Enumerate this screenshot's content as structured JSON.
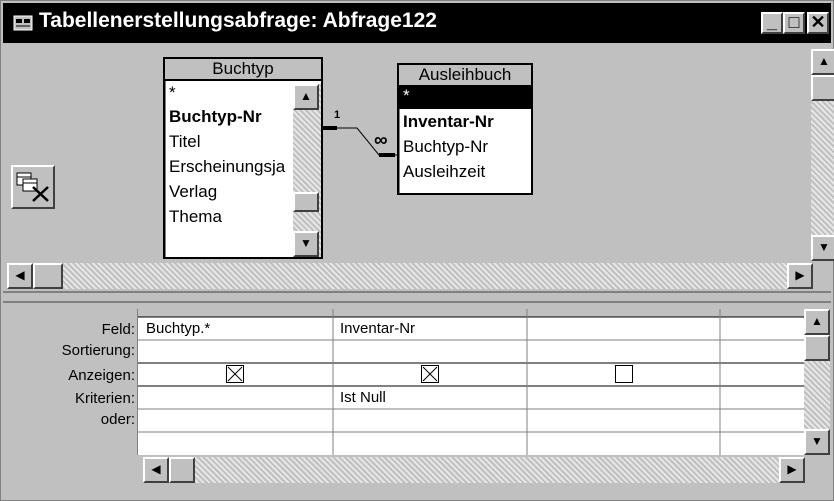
{
  "window": {
    "title": "Tabellenerstellungsabfrage: Abfrage122",
    "controls": {
      "minimize": "_",
      "maximize": "□",
      "close": "✕"
    }
  },
  "tables": [
    {
      "name": "Buchtyp",
      "fields": [
        "*",
        "Buchtyp-Nr",
        "Titel",
        "Erscheinungsja",
        "Verlag",
        "Thema"
      ]
    },
    {
      "name": "Ausleihbuch",
      "fields": [
        "*",
        "Inventar-Nr",
        "Buchtyp-Nr",
        "Ausleihzeit"
      ]
    }
  ],
  "relationship": {
    "one_label": "1",
    "many_label": "∞"
  },
  "grid": {
    "row_labels": [
      "Feld:",
      "Sortierung:",
      "Anzeigen:",
      "Kriterien:",
      "oder:"
    ],
    "columns": [
      {
        "feld": "Buchtyp.*",
        "sortierung": "",
        "anzeigen": true,
        "kriterien": "",
        "oder": ""
      },
      {
        "feld": "Inventar-Nr",
        "sortierung": "",
        "anzeigen": true,
        "kriterien": "Ist Null",
        "oder": ""
      },
      {
        "feld": "",
        "sortierung": "",
        "anzeigen": false,
        "kriterien": "",
        "oder": ""
      },
      {
        "feld": "",
        "sortierung": "",
        "anzeigen": null,
        "kriterien": "",
        "oder": ""
      }
    ]
  },
  "icons": {
    "title_icon": "query-icon",
    "side_icon": "delete-table-icon"
  }
}
